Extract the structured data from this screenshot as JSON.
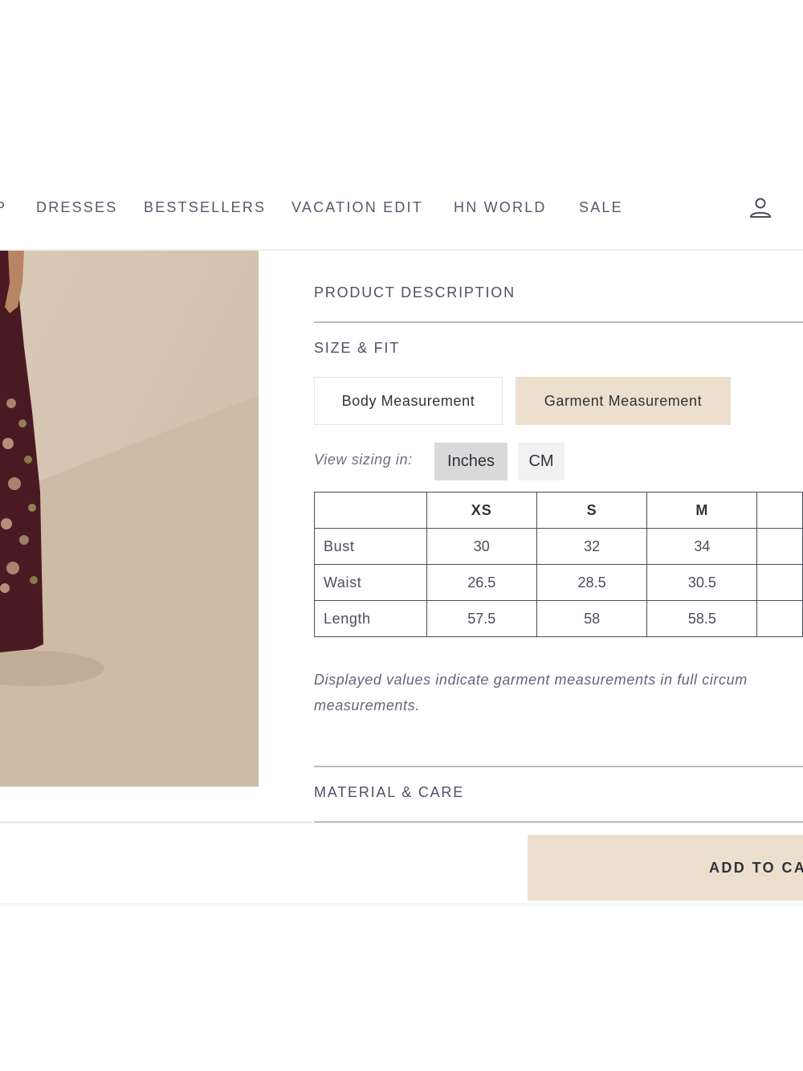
{
  "nav": {
    "items": [
      "P",
      "DRESSES",
      "BESTSELLERS",
      "VACATION EDIT",
      "HN WORLD",
      "SALE"
    ]
  },
  "icons": {
    "account": "user-icon"
  },
  "sections": {
    "product_description": "PRODUCT DESCRIPTION",
    "size_fit": "SIZE & FIT",
    "material_care": "MATERIAL & CARE"
  },
  "measurement_tabs": {
    "body": "Body Measurement",
    "garment": "Garment Measurement",
    "selected": "Garment Measurement"
  },
  "units": {
    "label": "View sizing in:",
    "inches": "Inches",
    "cm": "CM",
    "selected": "Inches"
  },
  "size_table": {
    "columns": [
      "",
      "XS",
      "S",
      "M",
      ""
    ],
    "rows": [
      {
        "label": "Bust",
        "values": [
          "30",
          "32",
          "34",
          ""
        ]
      },
      {
        "label": "Waist",
        "values": [
          "26.5",
          "28.5",
          "30.5",
          ""
        ]
      },
      {
        "label": "Length",
        "values": [
          "57.5",
          "58",
          "58.5",
          ""
        ]
      }
    ]
  },
  "note": {
    "line1": "Displayed values indicate garment measurements in full circum",
    "line2": "measurements."
  },
  "cart": {
    "label": "ADD TO CA"
  },
  "colors": {
    "accent_beige": "#eddfcd",
    "dress_maroon": "#4a1a22",
    "photo_background": "#d7c7b4"
  }
}
